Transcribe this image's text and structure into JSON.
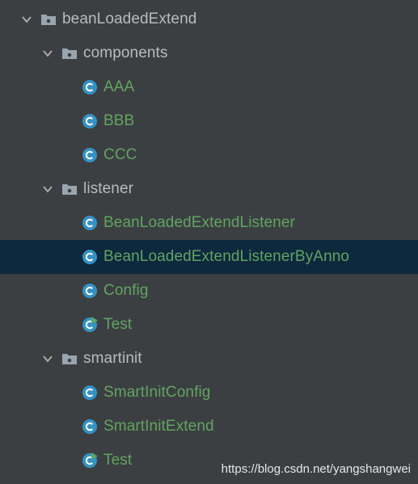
{
  "colors": {
    "background": "#3c3f41",
    "selected_row": "#0d293e",
    "folder_text": "#bbbbbb",
    "class_text": "#62a362",
    "class_icon": "#3592c4",
    "run_marker": "#59a869"
  },
  "tree": {
    "root": {
      "label": "beanLoadedExtend",
      "icon": "package-folder-icon",
      "expanded": true
    },
    "components": {
      "label": "components",
      "icon": "package-folder-icon",
      "expanded": true,
      "items": [
        {
          "label": "AAA",
          "icon": "class-icon"
        },
        {
          "label": "BBB",
          "icon": "class-icon"
        },
        {
          "label": "CCC",
          "icon": "class-icon"
        }
      ]
    },
    "listener": {
      "label": "listener",
      "icon": "package-folder-icon",
      "expanded": true,
      "items": [
        {
          "label": "BeanLoadedExtendListener",
          "icon": "class-icon"
        },
        {
          "label": "BeanLoadedExtendListenerByAnno",
          "icon": "class-icon",
          "selected": true
        },
        {
          "label": "Config",
          "icon": "class-icon"
        },
        {
          "label": "Test",
          "icon": "runnable-class-icon"
        }
      ]
    },
    "smartinit": {
      "label": "smartinit",
      "icon": "package-folder-icon",
      "expanded": true,
      "items": [
        {
          "label": "SmartInitConfig",
          "icon": "class-icon"
        },
        {
          "label": "SmartInitExtend",
          "icon": "class-icon"
        },
        {
          "label": "Test",
          "icon": "runnable-class-icon"
        }
      ]
    }
  },
  "watermark": "https://blog.csdn.net/yangshangwei"
}
